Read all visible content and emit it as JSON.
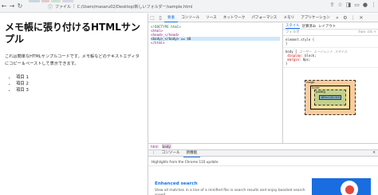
{
  "browser": {
    "address_label": "ファイル",
    "address_path": "C:/Users/masaru02/Desktop/新しいフォルダー/sample.html"
  },
  "page": {
    "heading": "メモ帳に張り付けるHTMLサンプル",
    "paragraph": "これは簡単なHTMLサンプルコードです。メモ帳などのテキストエディタにコピー＆ペーストして表示できます。",
    "list_items": [
      "項目 1",
      "項目 2",
      "項目 3"
    ]
  },
  "devtools": {
    "tabs": [
      "要素",
      "コンソール",
      "ソース",
      "ネットワーク",
      "パフォーマンス",
      "メモリ",
      "アプリケーション"
    ],
    "active_tab": "要素",
    "dom_lines": [
      "<!DOCTYPE html>",
      "<html>",
      "  <head>_</head>",
      "  <body>_</body>  == $0",
      "</html>"
    ],
    "styles_tabs": [
      "スタイル",
      "計算済み",
      "レイアウト"
    ],
    "filter_placeholder": "フィルタ",
    "filter_right": ":hov .cls +",
    "rules": [
      {
        "selector": "element.style {",
        "note": ""
      },
      {
        "selector": "body {",
        "note": "ユーザー エージェント スタイル"
      }
    ],
    "rule_props": [
      {
        "name": "display",
        "value": "block;"
      },
      {
        "name": "margin",
        "value": "8px;"
      }
    ],
    "box_model": {
      "margin_label": "margin",
      "border_label": "border",
      "padding_label": "padding",
      "content": "169×120.010"
    },
    "breadcrumbs": [
      "html",
      "body"
    ],
    "drawer_tabs": [
      "コンソール",
      "新機能"
    ],
    "highlight_text": "Highlights from the Chrome 110 update",
    "whats_new": {
      "title": "Enhanced search",
      "desc": "View all matches in a line of a minified file in search results and enjoy boosted search speed."
    }
  }
}
